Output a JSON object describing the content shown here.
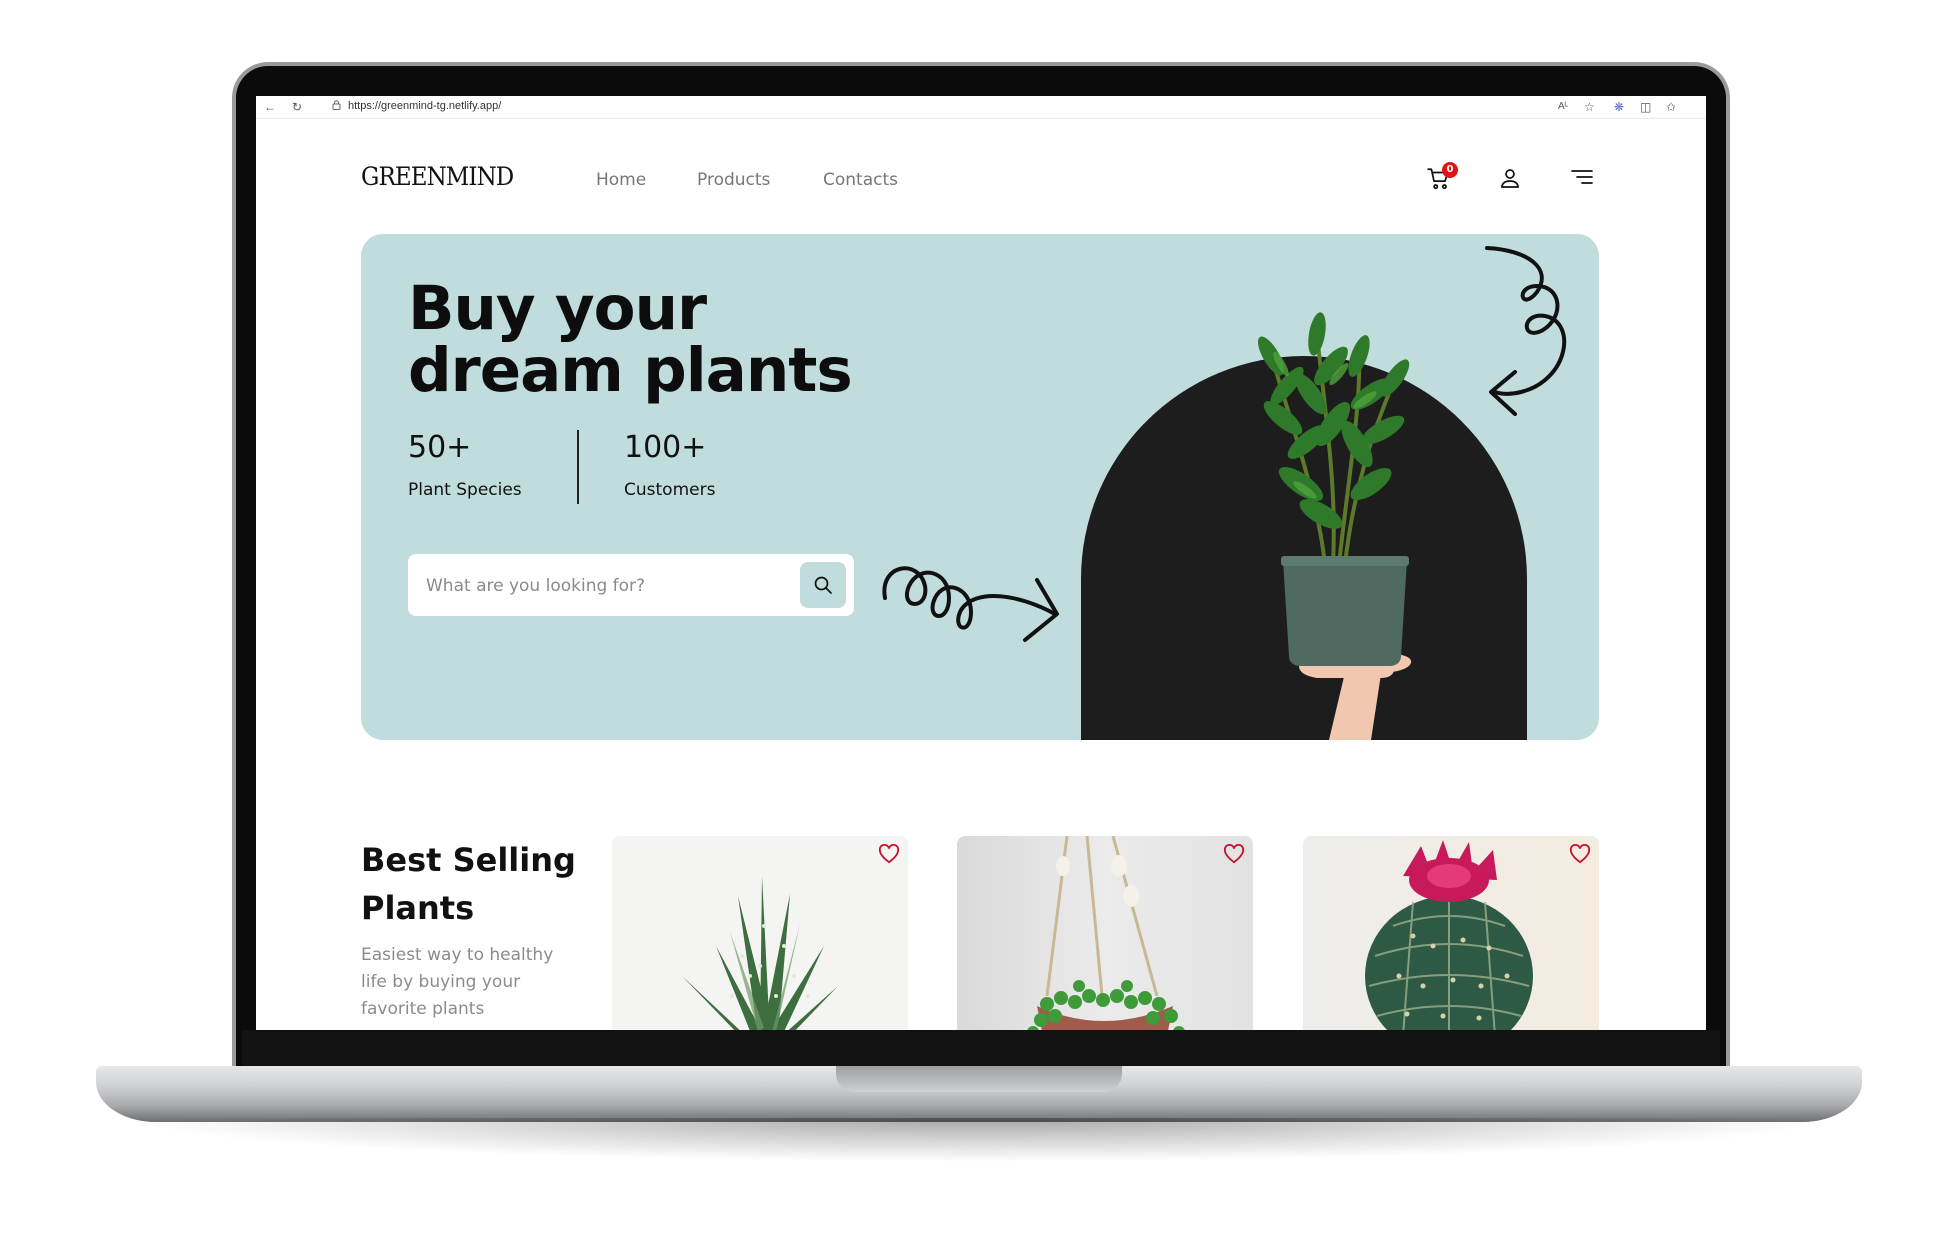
{
  "browser": {
    "url": "https://greenmind-tg.netlify.app/"
  },
  "nav": {
    "logo": "GREENMIND",
    "links": [
      "Home",
      "Products",
      "Contacts"
    ],
    "cart_count": "0"
  },
  "hero": {
    "title_line1": "Buy your",
    "title_line2": "dream plants",
    "stats": [
      {
        "value": "50+",
        "label": "Plant Species"
      },
      {
        "value": "100+",
        "label": "Customers"
      }
    ],
    "search_placeholder": "What are you looking for?",
    "background_color": "#c1dcdc"
  },
  "best_selling": {
    "title_line1": "Best Selling",
    "title_line2": "Plants",
    "subtitle": "Easiest way to healthy life by buying your favorite plants",
    "products": [
      {
        "image": "aloe-plant"
      },
      {
        "image": "hanging-string-of-pearls-plant"
      },
      {
        "image": "flowering-cactus"
      }
    ]
  },
  "colors": {
    "accent": "#c1dcdc",
    "heart": "#c8102e",
    "badge": "#e01414"
  }
}
